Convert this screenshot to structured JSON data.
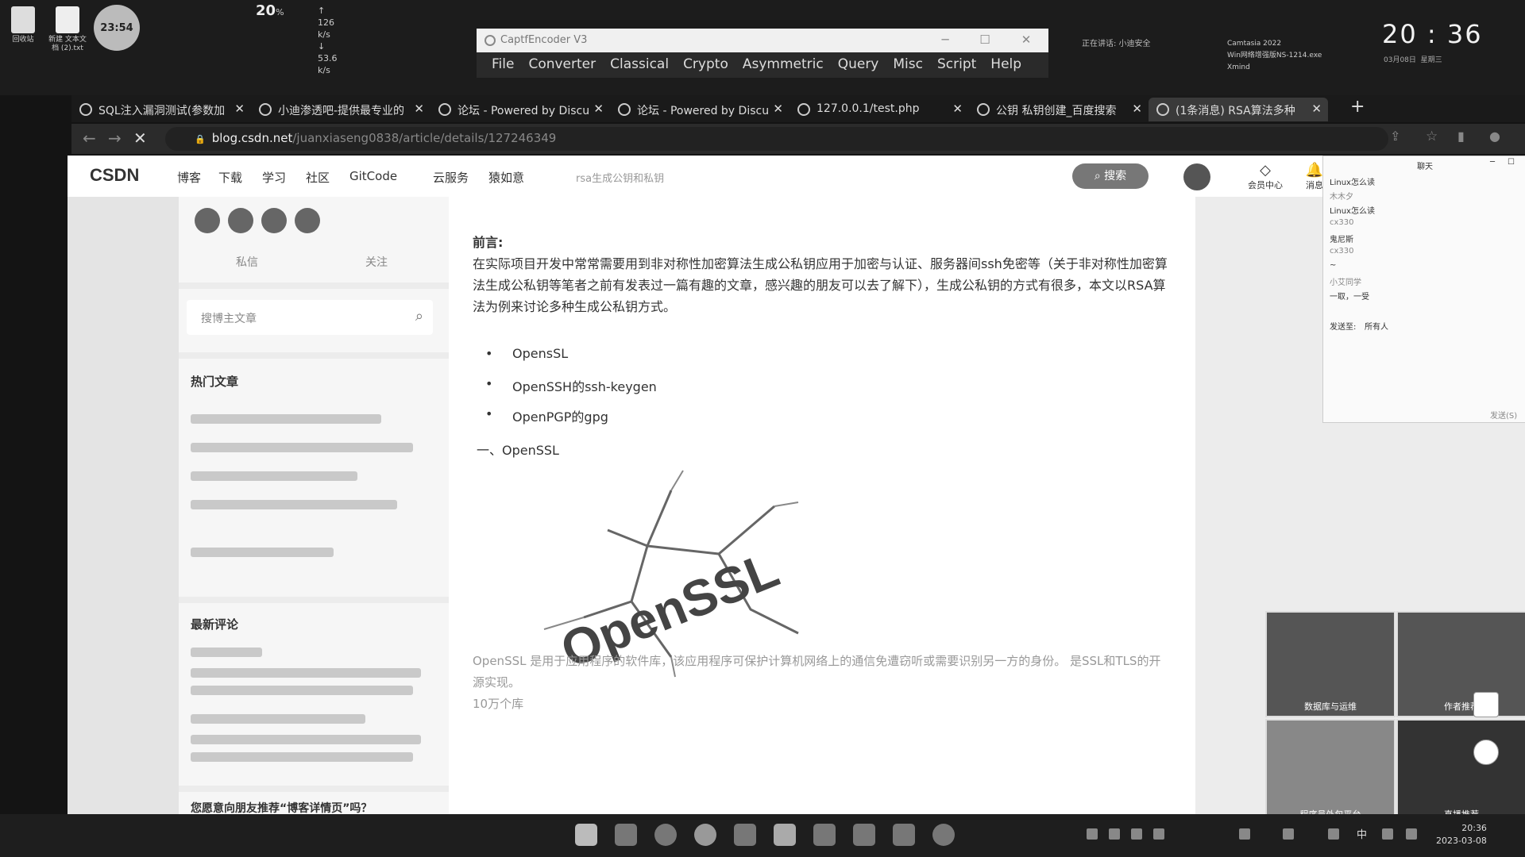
{
  "desktop": {
    "icons": [
      {
        "name": "recycle-bin",
        "label": "回收站"
      },
      {
        "name": "text-file",
        "label": "新建 文本文档 (2).txt"
      }
    ],
    "timer": "23:54",
    "net": {
      "percent": "20",
      "unit": "%",
      "up": "126 k/s",
      "down": "53.6 k/s"
    },
    "mic_status": "正在讲话: 小迪安全"
  },
  "captfencoder": {
    "title": "CaptfEncoder V3",
    "menu": [
      "File",
      "Converter",
      "Classical",
      "Crypto",
      "Asymmetric",
      "Query",
      "Misc",
      "Script",
      "Help"
    ]
  },
  "recent": {
    "items": [
      "Camtasia 2022",
      "Win网络增强版NS-1214.exe",
      "Xmind"
    ]
  },
  "clock": {
    "time": "20 : 36",
    "date": "03月08日",
    "weekday": "星期三"
  },
  "tabs": [
    {
      "title": "SQL注入漏洞测试(参数加",
      "active": false
    },
    {
      "title": "小迪渗透吧-提供最专业的",
      "active": false
    },
    {
      "title": "论坛 - Powered by Discu",
      "active": false
    },
    {
      "title": "论坛 - Powered by Discu",
      "active": false
    },
    {
      "title": "127.0.0.1/test.php",
      "active": false
    },
    {
      "title": "公钥 私钥创建_百度搜索",
      "active": false
    },
    {
      "title": "(1条消息) RSA算法多种",
      "active": true
    }
  ],
  "address": {
    "host": "blog.csdn.net",
    "path": "/juanxiaseng0838/article/details/127246349"
  },
  "csdn_nav": {
    "logo": "CSDN",
    "items": [
      "博客",
      "下载",
      "学习",
      "社区",
      "GitCode",
      "云服务",
      "猿如意"
    ],
    "search_hint": "rsa生成公钥和私钥",
    "search_button": "搜索",
    "vip_label": "会员中心",
    "msg_label": "消息"
  },
  "sidebar": {
    "private_msg": "私信",
    "follow": "关注",
    "search_placeholder": "搜博主文章",
    "hot_heading": "热门文章",
    "comments_heading": "最新评论",
    "recommend_heading": "您愿意向朋友推荐“博客详情页”吗？"
  },
  "article": {
    "preface_label": "前言:",
    "preface_body": "在实际项目开发中常常需要用到非对称性加密算法生成公私钥应用于加密与认证、服务器间ssh免密等（关于非对称性加密算法生成公私钥等笔者之前有发表过一篇有趣的文章，感兴趣的朋友可以去了解下），生成公私钥的方式有很多，本文以RSA算法为例来讨论多种生成公私钥方式。",
    "bullets": [
      "OpensSL",
      "OpenSSH的ssh-keygen",
      "OpenPGP的gpg"
    ],
    "section1": "一、OpenSSL",
    "logo_text": "OpenSSL",
    "para2": "OpenSSL 是用于应用程序的软件库，该应用程序可保护计算机网络上的通信免遭窃听或需要识别另一方的身份。 是SSL和TLS的开源实现。",
    "para3": "10万个库"
  },
  "chat": {
    "title": "聊天",
    "lines": [
      "Linux怎么读",
      "木木夕",
      "Linux怎么读",
      "cx330",
      "鬼尼斯",
      "cx330",
      "~",
      "小艾同学",
      "一取，一受"
    ],
    "send_to_label": "发送至:",
    "send_to_value": "所有人",
    "send_button": "发送(S)"
  },
  "thumbnails": [
    "数据库与运维",
    "作者推荐",
    "程序员外包平台",
    "直播推荐"
  ],
  "taskbar": {
    "time": "20:36",
    "date": "2023-03-08",
    "lang": "中"
  }
}
